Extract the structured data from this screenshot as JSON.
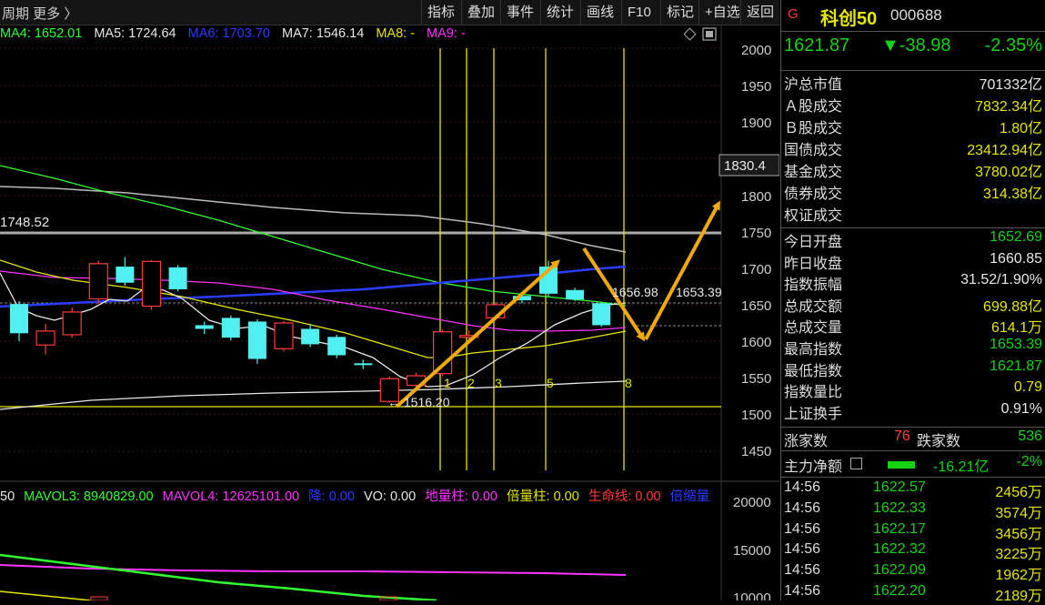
{
  "toolbar": {
    "period_label": "周期  更多 〉",
    "buttons": [
      "指标",
      "叠加",
      "事件",
      "统计",
      "画线",
      "F10",
      "标记",
      "+自选",
      "返回"
    ]
  },
  "ma_legend": [
    {
      "text": "MA4: 1652.01",
      "color": "#32ff32"
    },
    {
      "text": "MA5: 1724.64",
      "color": "#e8e8e8"
    },
    {
      "text": "MA6: 1703.70",
      "color": "#2a3cff"
    },
    {
      "text": "MA7: 1546.14",
      "color": "#e8e8e8"
    },
    {
      "text": "MA8: -",
      "color": "#e6e600"
    },
    {
      "text": "MA9: -",
      "color": "#ff33ff"
    }
  ],
  "price_axis": [
    "2000",
    "1950",
    "1900",
    "1800",
    "1750",
    "1700",
    "1650",
    "1600",
    "1550",
    "1500",
    "1450"
  ],
  "price_marker": "1830.4",
  "chart_labels": {
    "high_left": "1748.52",
    "low_mark": "← 1516.20",
    "val_a": "1656.98",
    "val_b": "1653.39",
    "counts": [
      "1",
      "2",
      "3",
      "5",
      "8"
    ]
  },
  "mavol_legend": [
    {
      "text": "50",
      "color": "#e8e8e8"
    },
    {
      "text": "MAVOL3: 8940829.00",
      "color": "#32ff32"
    },
    {
      "text": "MAVOL4: 12625101.00",
      "color": "#ff33ff"
    },
    {
      "text": "降: 0.00",
      "color": "#2a3cff"
    },
    {
      "text": "VO: 0.00",
      "color": "#e8e8e8"
    },
    {
      "text": "地量柱: 0.00",
      "color": "#ff33ff"
    },
    {
      "text": "倍量柱: 0.00",
      "color": "#e6e600"
    },
    {
      "text": "生命线: 0.00",
      "color": "#ff3b3b"
    },
    {
      "text": "倍缩量",
      "color": "#2a3cff"
    }
  ],
  "volume_axis": [
    "20000",
    "15000",
    "10000"
  ],
  "quote": {
    "badge": "G",
    "name": "科创50",
    "code": "000688",
    "price": "1621.87",
    "change": "▼-38.98",
    "change_pct": "-2.35%"
  },
  "market_rows": [
    {
      "k": "沪总市值",
      "v": "701332亿",
      "c": "white"
    },
    {
      "k": "Ａ股成交",
      "v": "7832.34亿",
      "c": "yellow"
    },
    {
      "k": "Ｂ股成交",
      "v": "1.80亿",
      "c": "yellow"
    },
    {
      "k": "国债成交",
      "v": "23412.94亿",
      "c": "yellow"
    },
    {
      "k": "基金成交",
      "v": "3780.02亿",
      "c": "yellow"
    },
    {
      "k": "债券成交",
      "v": "314.38亿",
      "c": "yellow"
    },
    {
      "k": "权证成交",
      "v": "",
      "c": "yellow"
    }
  ],
  "index_rows": [
    {
      "k": "今日开盘",
      "v": "1652.69",
      "c": "green"
    },
    {
      "k": "昨日收盘",
      "v": "1660.85",
      "c": "white"
    },
    {
      "k": "指数振幅",
      "v": "31.52/1.90%",
      "c": "white"
    },
    {
      "k": "总成交额",
      "v": "699.88亿",
      "c": "yellow"
    },
    {
      "k": "总成交量",
      "v": "614.1万",
      "c": "yellow"
    },
    {
      "k": "最高指数",
      "v": "1653.39",
      "c": "green"
    },
    {
      "k": "最低指数",
      "v": "1621.87",
      "c": "green"
    },
    {
      "k": "指数量比",
      "v": "0.79",
      "c": "yellow"
    },
    {
      "k": "上证换手",
      "v": "0.91%",
      "c": "white"
    }
  ],
  "breadth": {
    "up_label": "涨家数",
    "up": "76",
    "down_label": "跌家数",
    "down": "536"
  },
  "main_flow": {
    "label": "主力净额",
    "value": "-16.21亿",
    "pct": "-2%"
  },
  "ticks": [
    {
      "time": "14:56",
      "price": "1622.57",
      "vol": "2456万"
    },
    {
      "time": "14:56",
      "price": "1622.33",
      "vol": "3574万"
    },
    {
      "time": "14:56",
      "price": "1622.17",
      "vol": "3456万"
    },
    {
      "time": "14:56",
      "price": "1622.32",
      "vol": "3225万"
    },
    {
      "time": "14:56",
      "price": "1622.09",
      "vol": "1962万"
    },
    {
      "time": "14:56",
      "price": "1622.20",
      "vol": "2189万"
    }
  ],
  "chart_data": {
    "type": "candlestick",
    "ylim": [
      1430,
      2030
    ],
    "candles": [
      {
        "o": 1651,
        "c": 1611,
        "h": 1655,
        "l": 1600
      },
      {
        "o": 1595,
        "c": 1614,
        "h": 1624,
        "l": 1582
      },
      {
        "o": 1609,
        "c": 1640,
        "h": 1646,
        "l": 1605
      },
      {
        "o": 1658,
        "c": 1706,
        "h": 1710,
        "l": 1652
      },
      {
        "o": 1702,
        "c": 1680,
        "h": 1715,
        "l": 1676
      },
      {
        "o": 1648,
        "c": 1709,
        "h": 1711,
        "l": 1643
      },
      {
        "o": 1701,
        "c": 1671,
        "h": 1704,
        "l": 1668
      },
      {
        "o": 1622,
        "c": 1617,
        "h": 1627,
        "l": 1610
      },
      {
        "o": 1632,
        "c": 1605,
        "h": 1635,
        "l": 1601
      },
      {
        "o": 1627,
        "c": 1576,
        "h": 1630,
        "l": 1569
      },
      {
        "o": 1590,
        "c": 1625,
        "h": 1628,
        "l": 1586
      },
      {
        "o": 1617,
        "c": 1596,
        "h": 1624,
        "l": 1592
      },
      {
        "o": 1606,
        "c": 1581,
        "h": 1609,
        "l": 1577
      },
      {
        "o": 1570,
        "c": 1568,
        "h": 1575,
        "l": 1562
      },
      {
        "o": 1518,
        "c": 1549,
        "h": 1552,
        "l": 1516
      },
      {
        "o": 1540,
        "c": 1553,
        "h": 1557,
        "l": 1537
      },
      {
        "o": 1556,
        "c": 1613,
        "h": 1616,
        "l": 1553
      },
      {
        "o": 1606,
        "c": 1608,
        "h": 1615,
        "l": 1600
      },
      {
        "o": 1632,
        "c": 1650,
        "h": 1653,
        "l": 1628
      },
      {
        "o": 1662,
        "c": 1656,
        "h": 1667,
        "l": 1652
      },
      {
        "o": 1702,
        "c": 1665,
        "h": 1710,
        "l": 1661
      },
      {
        "o": 1670,
        "c": 1657,
        "h": 1673,
        "l": 1655
      },
      {
        "o": 1652,
        "c": 1622,
        "h": 1653,
        "l": 1620
      }
    ]
  }
}
